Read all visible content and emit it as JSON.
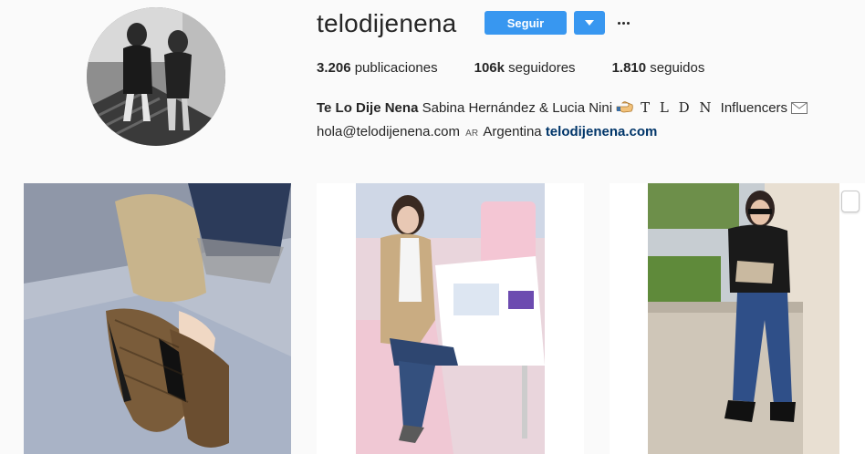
{
  "profile": {
    "username": "telodijenena",
    "follow_label": "Seguir",
    "stats": {
      "posts_count": "3.206",
      "posts_label": "publicaciones",
      "followers_count": "106k",
      "followers_label": "seguidores",
      "following_count": "1.810",
      "following_label": "seguidos"
    },
    "bio": {
      "full_name": "Te Lo Dije Nena",
      "names": "Sabina Hernández & Lucia Nini",
      "pointing_hand_icon": "pointing-hand-icon",
      "tldn": "T L D N",
      "influencers": "Influencers",
      "envelope_icon": "envelope-icon",
      "email": "hola@telodijenena.com",
      "flag": "AR",
      "country": "Argentina",
      "website": "telodijenena.com"
    }
  },
  "icons": {
    "dropdown": "chevron-down-icon",
    "options": "more-options-icon"
  },
  "colors": {
    "accent": "#3897f0",
    "link": "#003569",
    "background": "#fafafa",
    "text": "#262626"
  },
  "posts": [
    {
      "id": "post-1"
    },
    {
      "id": "post-2"
    },
    {
      "id": "post-3"
    }
  ]
}
